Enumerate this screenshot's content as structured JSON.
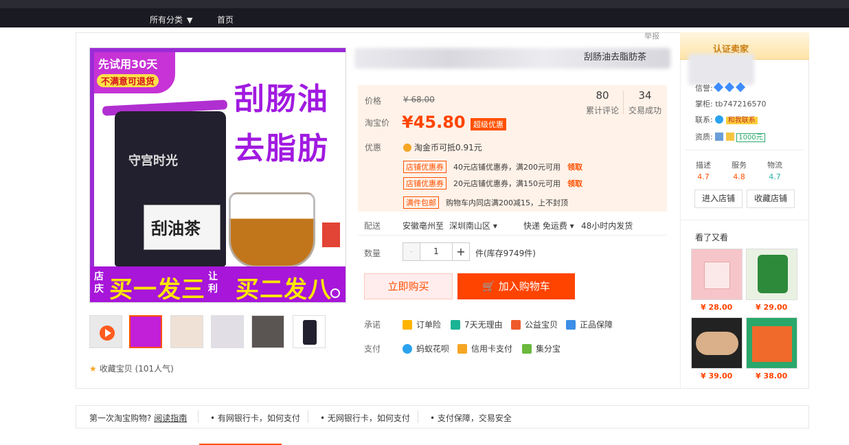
{
  "topnav": {
    "category_label": "所有分类",
    "home_label": "首页"
  },
  "report_label": "举报",
  "product": {
    "title_visible": "刮肠油去脂肪茶",
    "hero": {
      "promo_line1": "先试用30天",
      "promo_line2": "不满意可退货",
      "headline1": "刮肠油",
      "headline2": "去脂肪",
      "bag_brand": "守宫时光",
      "bag_label": "刮油茶",
      "banner_left": "店庆",
      "banner_mid1": "买一发三",
      "banner_mid2": "让利",
      "banner_right": "买二发八"
    },
    "price": {
      "price_label": "价格",
      "original_price": "¥ 68.00",
      "promo_label": "淘宝价",
      "promo_price": "¥45.80",
      "promo_badge": "超级优惠"
    },
    "stats": [
      {
        "value": "80",
        "label": "累计评论"
      },
      {
        "value": "34",
        "label": "交易成功"
      }
    ],
    "offers": {
      "label": "优惠",
      "coin_text": "淘金币可抵0.91元",
      "coupons": [
        {
          "tag": "店铺优惠券",
          "text": "40元店铺优惠券，满200元可用",
          "get": "领取"
        },
        {
          "tag": "店铺优惠券",
          "text": "20元店铺优惠券，满150元可用",
          "get": "领取"
        }
      ],
      "freight_tag": "满件包邮",
      "freight_text": "购物车内同店满200减15，上不封顶"
    },
    "shipping": {
      "label": "配送",
      "text1": "安徽亳州至",
      "text2": "深圳南山区",
      "text3": "快递 免运费",
      "text4": "48小时内发货"
    },
    "quantity": {
      "label": "数量",
      "value": "1",
      "minus": "-",
      "plus": "+",
      "stock_text": "件(库存9749件)"
    },
    "buttons": {
      "buy_now": "立即购买",
      "add_cart": "加入购物车"
    },
    "promise": {
      "label": "承诺",
      "items": [
        "订单险",
        "7天无理由",
        "公益宝贝",
        "正品保障"
      ]
    },
    "payment": {
      "label": "支付",
      "items": [
        "蚂蚁花呗",
        "信用卡支付",
        "集分宝"
      ]
    },
    "favorite_text": "收藏宝贝 (101人气)"
  },
  "shop": {
    "header": "认证卖家",
    "level_label": "信誉:",
    "account_label": "掌柜:",
    "account_value": "tb747216570",
    "contact_label": "联系:",
    "contact_button": "和我联系",
    "qual_label": "资质:",
    "deposit_label": "1000元",
    "ratings": [
      {
        "label": "描述",
        "value": "4.7",
        "color": "orange"
      },
      {
        "label": "服务",
        "value": "4.8",
        "color": "orange"
      },
      {
        "label": "物流",
        "value": "4.7",
        "color": "green"
      }
    ],
    "enter_shop": "进入店铺",
    "fav_shop": "收藏店铺"
  },
  "looked": {
    "title": "看了又看",
    "items": [
      {
        "price": "¥ 28.00",
        "color": "#f6c5c9"
      },
      {
        "price": "¥ 29.00",
        "color": "#2d8a3b"
      },
      {
        "price": "¥ 39.00",
        "color": "#222222"
      },
      {
        "price": "¥ 38.00",
        "color": "#2aa86c"
      }
    ]
  },
  "footer": {
    "first_time": "第一次淘宝购物?",
    "link": "阅读指南",
    "items": [
      "有网银行卡，如何支付",
      "无网银行卡，如何支付",
      "支付保障，交易安全"
    ]
  }
}
